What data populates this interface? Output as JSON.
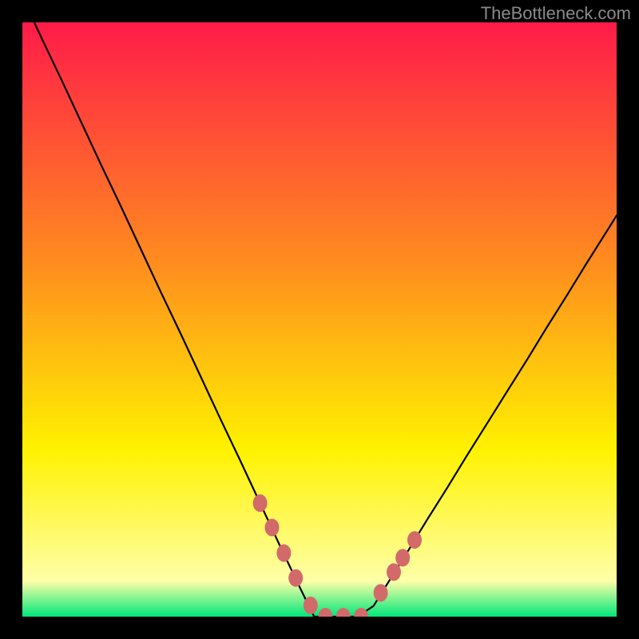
{
  "watermark": "TheBottleneck.com",
  "chart_data": {
    "type": "line",
    "title": "",
    "xlabel": "",
    "ylabel": "",
    "xlim": [
      0,
      1
    ],
    "ylim": [
      0,
      1
    ],
    "grid": false,
    "background": "red-yellow-green vertical gradient",
    "series": [
      {
        "name": "curve",
        "color": "#000000",
        "x": [
          0.0,
          0.033,
          0.067,
          0.1,
          0.133,
          0.167,
          0.2,
          0.233,
          0.267,
          0.3,
          0.333,
          0.367,
          0.4,
          0.433,
          0.467,
          0.491,
          0.511,
          0.538,
          0.564,
          0.591,
          0.614,
          0.648,
          0.681,
          0.715,
          0.748,
          0.782,
          0.815,
          0.849,
          0.882,
          0.916,
          0.949,
          0.983,
          1.0
        ],
        "y": [
          1.043,
          0.972,
          0.901,
          0.83,
          0.759,
          0.688,
          0.617,
          0.546,
          0.475,
          0.404,
          0.333,
          0.262,
          0.191,
          0.12,
          0.049,
          0.0,
          0.0,
          0.0,
          0.0,
          0.018,
          0.055,
          0.109,
          0.163,
          0.217,
          0.271,
          0.325,
          0.378,
          0.432,
          0.486,
          0.54,
          0.594,
          0.648,
          0.675
        ]
      },
      {
        "name": "markers",
        "color": "#d36a6a",
        "type": "scatter",
        "x": [
          0.4,
          0.42,
          0.44,
          0.46,
          0.485,
          0.51,
          0.54,
          0.57,
          0.603,
          0.625,
          0.64,
          0.66
        ],
        "y": [
          0.191,
          0.15,
          0.107,
          0.065,
          0.019,
          0.0,
          0.0,
          0.0,
          0.04,
          0.075,
          0.099,
          0.129
        ]
      }
    ]
  },
  "gradient_colors": {
    "top": "#ff1b49",
    "upper_mid": "#ff8b1f",
    "lower_mid": "#fff200",
    "pale_band": "#ffffa8",
    "bottom": "#00e77a"
  }
}
